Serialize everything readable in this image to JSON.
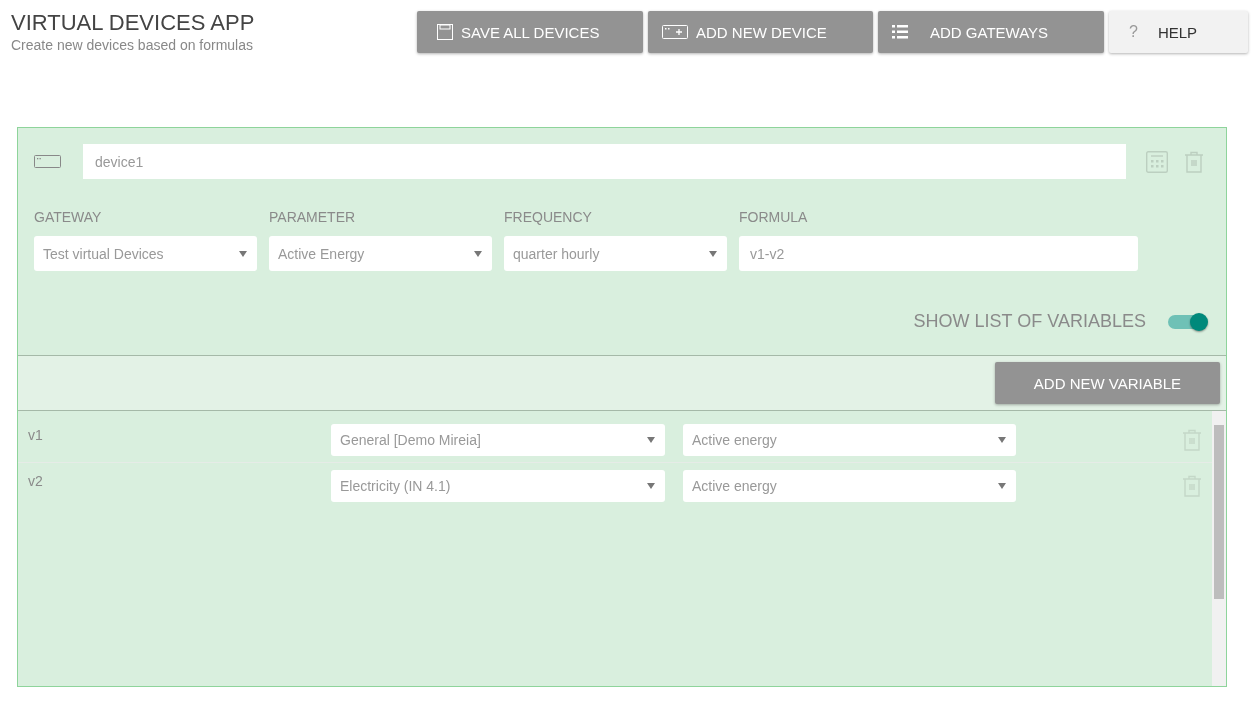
{
  "header": {
    "title": "VIRTUAL DEVICES APP",
    "subtitle": "Create new devices based on formulas"
  },
  "toolbar": [
    {
      "kind": "save",
      "label": "SAVE ALL DEVICES"
    },
    {
      "kind": "add-device",
      "label": "ADD NEW DEVICE"
    },
    {
      "kind": "list",
      "label": "ADD GATEWAYS"
    },
    {
      "kind": "help",
      "label": "HELP",
      "icon": "?"
    }
  ],
  "device": {
    "name": "device1",
    "fields": [
      {
        "kind": "select",
        "label": "GATEWAY",
        "value": "Test virtual Devices"
      },
      {
        "kind": "select",
        "label": "PARAMETER",
        "value": "Active Energy"
      },
      {
        "kind": "select",
        "label": "FREQUENCY",
        "value": "quarter hourly"
      },
      {
        "kind": "text",
        "label": "FORMULA",
        "value": "v1-v2"
      }
    ],
    "show_variables": {
      "label": "SHOW LIST OF VARIABLES",
      "on": true
    },
    "add_variable_button": "ADD NEW VARIABLE",
    "variables": [
      {
        "name": "v1",
        "source": "General [Demo Mireia]",
        "parameter": "Active energy"
      },
      {
        "name": "v2",
        "source": "Electricity (IN 4.1)",
        "parameter": "Active energy"
      }
    ]
  }
}
